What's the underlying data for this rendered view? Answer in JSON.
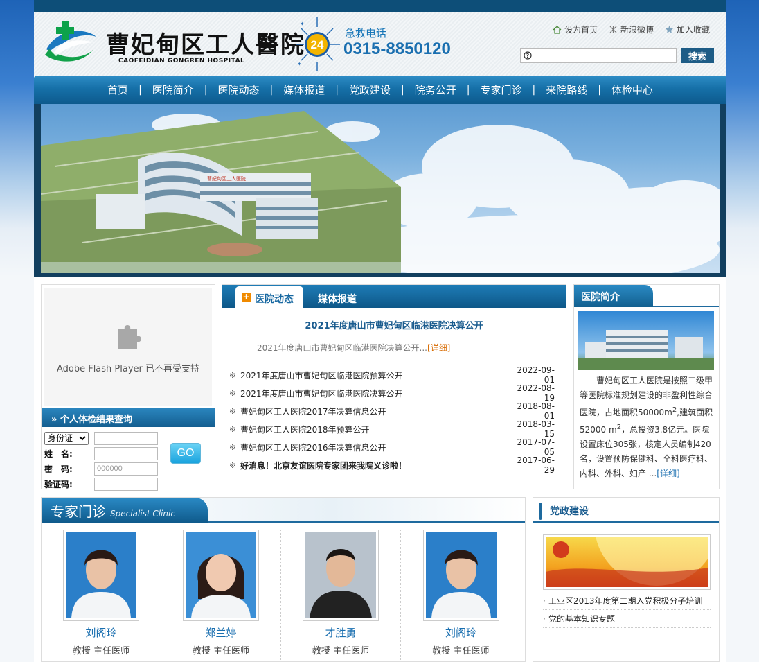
{
  "header": {
    "logo_cn": "曹妃甸区工人醫院",
    "logo_en": "CAOFEIDIAN GONGREN HOSPITAL",
    "hotline_badge": "24",
    "hotline_label": "急救电话",
    "hotline_number": "0315-8850120",
    "links": [
      "设为首页",
      "新浪微博",
      "加入收藏"
    ],
    "search_placeholder": "",
    "search_button": "搜索"
  },
  "nav": [
    "首页",
    "医院简介",
    "医院动态",
    "媒体报道",
    "党政建设",
    "院务公开",
    "专家门诊",
    "来院路线",
    "体检中心"
  ],
  "banner": {
    "building_sign": "曹妃甸区工人医院"
  },
  "flash": {
    "message": "Adobe Flash Player 已不再受支持"
  },
  "query": {
    "title": "个人体检结果查询",
    "id_type": "身份证",
    "name_label": "姓　名:",
    "password_label": "密　码:",
    "password_value": "000000",
    "captcha_label": "验证码:",
    "go_button": "GO"
  },
  "news": {
    "tab_active": "医院动态",
    "tab_other": "媒体报道",
    "headline": "2021年度唐山市曹妃甸区临港医院决算公开",
    "summary": "2021年度唐山市曹妃甸区临港医院决算公开...",
    "summary_more": "[详细]",
    "items": [
      {
        "title": "2021年度唐山市曹妃甸区临港医院预算公开",
        "date": "2022-09-01",
        "bold": false
      },
      {
        "title": "2021年度唐山市曹妃甸区临港医院决算公开",
        "date": "2022-08-19",
        "bold": false
      },
      {
        "title": "曹妃甸区工人医院2017年决算信息公开",
        "date": "2018-08-01",
        "bold": false
      },
      {
        "title": "曹妃甸区工人医院2018年预算公开",
        "date": "2018-03-15",
        "bold": false
      },
      {
        "title": "曹妃甸区工人医院2016年决算信息公开",
        "date": "2017-07-05",
        "bold": false
      },
      {
        "title": "好消息！北京友谊医院专家团来我院义诊啦！",
        "date": "2017-06-29",
        "bold": true
      }
    ]
  },
  "intro": {
    "title": "医院简介",
    "text_a": "曹妃甸区工人医院是按照二级甲等医院标准规划建设的非盈利性综合医院，占地面积50000m",
    "text_b": ",建筑面积52000 m",
    "text_c": "，总投资3.8亿元。医院设置床位305张，核定人员编制420名，设置预防保健科、全科医疗科、内科、外科、妇产 ...",
    "sup": "2",
    "more": "[详细]"
  },
  "specialist": {
    "title_cn": "专家门诊",
    "title_en": "Specialist Clinic",
    "doctors": [
      {
        "name": "刘阁玲",
        "title": "教授 主任医师"
      },
      {
        "name": "郑兰婷",
        "title": "教授 主任医师"
      },
      {
        "name": "才胜勇",
        "title": "教授 主任医师"
      },
      {
        "name": "刘阁玲",
        "title": "教授 主任医师"
      }
    ]
  },
  "party": {
    "title": "党政建设",
    "items": [
      "工业区2013年度第二期入党积极分子培训",
      "党的基本知识专题"
    ]
  },
  "colors": {
    "primary": "#1670a8",
    "dark": "#0d4e78",
    "accent": "#f08a00"
  }
}
